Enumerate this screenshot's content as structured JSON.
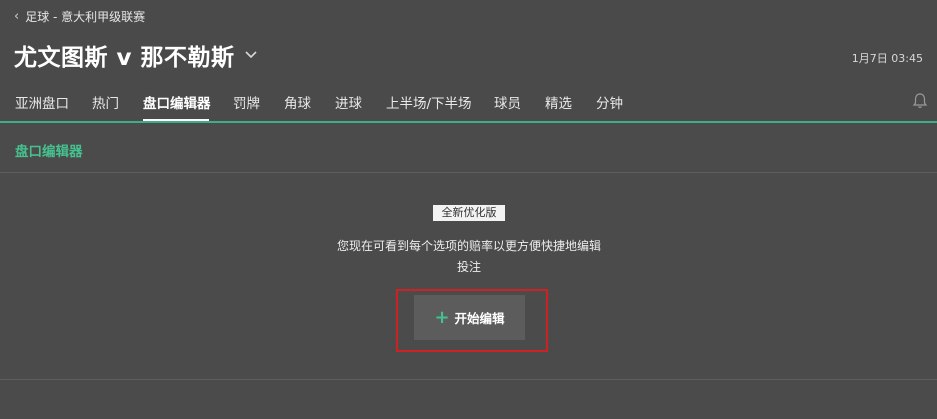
{
  "breadcrumb": {
    "text": "足球 - 意大利甲级联赛"
  },
  "match": {
    "title": "尤文图斯 v 那不勒斯",
    "datetime": "1月7日 03:45"
  },
  "tabs": [
    {
      "label": "亚洲盘口"
    },
    {
      "label": "热门"
    },
    {
      "label": "盘口编辑器",
      "active": true
    },
    {
      "label": "罚牌"
    },
    {
      "label": "角球"
    },
    {
      "label": "进球"
    },
    {
      "label": "上半场/下半场"
    },
    {
      "label": "球员"
    },
    {
      "label": "精选"
    },
    {
      "label": "分钟"
    }
  ],
  "section": {
    "title": "盘口编辑器"
  },
  "content": {
    "badge": "全新优化版",
    "description_line1": "您现在可看到每个选项的赔率以更方便快捷地编辑",
    "description_line2": "投注",
    "start_button": "开始编辑"
  },
  "colors": {
    "accent": "#45c08f",
    "highlight": "#cc2222",
    "background": "#4b4b4b"
  },
  "icons": {
    "back": "chevron-left-icon",
    "dropdown": "chevron-down-icon",
    "notification": "bell-icon",
    "add": "plus-icon"
  }
}
